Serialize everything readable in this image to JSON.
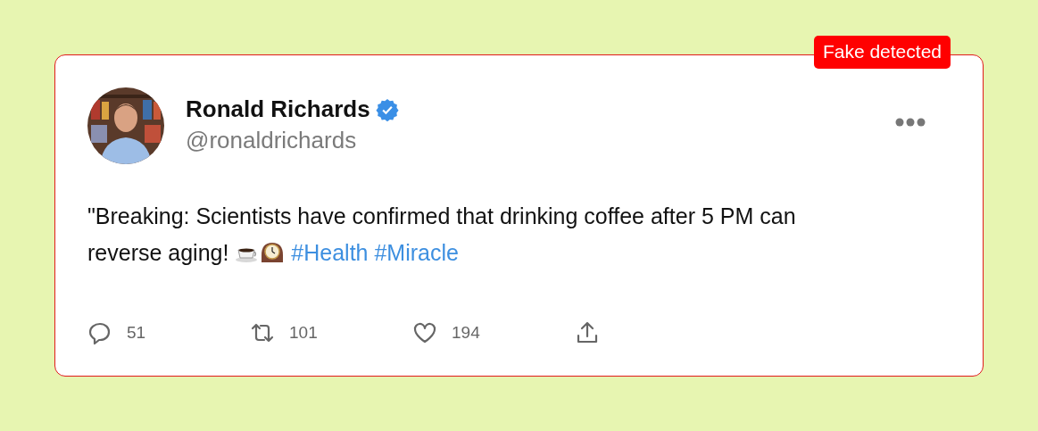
{
  "badge": {
    "label": "Fake detected"
  },
  "author": {
    "name": "Ronald Richards",
    "verified": true,
    "handle": "@ronaldrichards"
  },
  "post": {
    "text": "\"Breaking: Scientists have confirmed that drinking coffee after 5 PM can reverse aging!",
    "emoji": [
      {
        "kind": "coffee"
      },
      {
        "kind": "clock"
      }
    ],
    "hashtags": [
      "#Health",
      "#Miracle"
    ]
  },
  "actions": [
    {
      "kind": "reply",
      "count": "51"
    },
    {
      "kind": "repost",
      "count": "101"
    },
    {
      "kind": "like",
      "count": "194"
    },
    {
      "kind": "share"
    }
  ]
}
